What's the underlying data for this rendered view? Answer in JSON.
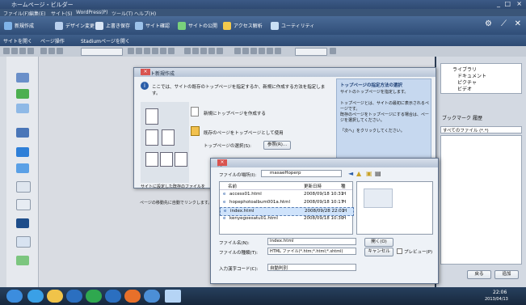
{
  "window": {
    "title": "ホームページ・ビルダー",
    "controls": [
      "_",
      "□",
      "×"
    ]
  },
  "menu": [
    "ファイル(F)",
    "編集(E)",
    "サイト(S)",
    "WordPress(P)",
    "ツール(T)",
    "ヘルプ(H)"
  ],
  "ribbon": [
    "新規作成",
    "デザイン変更",
    "上書き保存",
    "サイト確認",
    "サイトの公開",
    "アクセス解析",
    "ユーティリティ"
  ],
  "ribbon2": [
    "サイトを開く",
    "ページ操作",
    "Stadiumページを開く"
  ],
  "rightpanel": {
    "tree": [
      "ライブラリ",
      "ドキュメント",
      "ピクチャ",
      "ビデオ"
    ],
    "tabs": [
      "ブックマーク",
      "履歴"
    ],
    "filter": "すべてのファイル (*.*)",
    "bottom_buttons": [
      "戻る",
      "追加"
    ]
  },
  "wizard": {
    "title": "サイト新規作成",
    "intro": "ここでは、サイトの既存のトップページを指定するか、新規に作成する方法を指定します。",
    "option1": "新規にトップページを作成する",
    "option2": "既存のページをトップページとして使用",
    "field_label": "トップページの選択(S):",
    "browse_btn": "参照(R)...",
    "help_title": "トップページの指定方法の選択",
    "help_lines": [
      "サイトのトップページを指定します。",
      "トップページとは、サイトの最初に表示されるページです。",
      "既存のページをトップページにする場合は、ページを選択してください。",
      "「次へ」をクリックしてください。"
    ],
    "bottom_note_1": "サイトに設定した既存のファイルを",
    "bottom_note_2": "ページの移動先に自動でリンクします。"
  },
  "open_dialog": {
    "title": "開く",
    "look_in_label": "ファイルの場所(I):",
    "look_in_value": "masaeHoperp",
    "columns": [
      "名前",
      "更新日時",
      "種"
    ],
    "files": [
      {
        "name": "access01.html",
        "date": "2008/09/18 10:31",
        "type": "H",
        "selected": false
      },
      {
        "name": "hopephotoalbum001a.html",
        "date": "2008/09/18 10:17",
        "type": "H",
        "selected": false
      },
      {
        "name": "index.html",
        "date": "2008/09/28 22:01",
        "type": "H",
        "selected": true
      },
      {
        "name": "kenyegoesatu01.html",
        "date": "2008/09/18 10:30",
        "type": "H",
        "selected": false
      }
    ],
    "filename_label": "ファイル名(N):",
    "filename_value": "index.html",
    "filetype_label": "ファイルの種類(T):",
    "filetype_value": "HTML ファイル(*.htm;*.html;*.shtml)",
    "encoding_label": "入力漢字コード(C):",
    "encoding_value": "自動判別",
    "open_btn": "開く(O)",
    "cancel_btn": "キャンセル",
    "preview_label": "プレビュー(P)"
  },
  "taskbar": {
    "time": "22:06",
    "date": "2013/04/13"
  },
  "colors": {
    "accent": "#2f4d77",
    "dialog": "#eef1f5",
    "selection": "#cfe3fb"
  }
}
